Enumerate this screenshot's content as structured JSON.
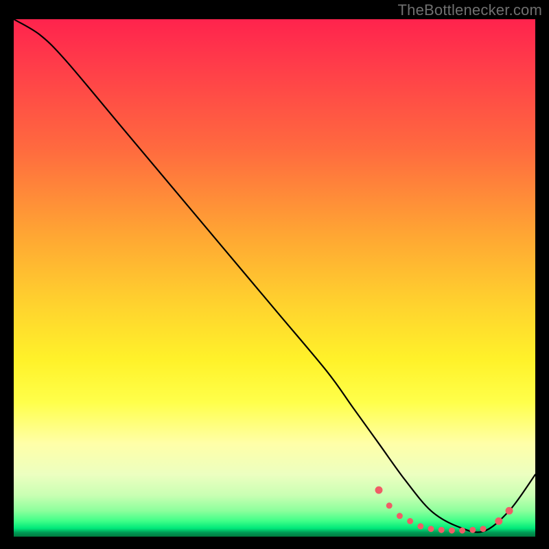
{
  "attribution": "TheBottlenecker.com",
  "chart_data": {
    "type": "line",
    "title": "",
    "xlabel": "",
    "ylabel": "",
    "xlim": [
      0,
      100
    ],
    "ylim": [
      0,
      100
    ],
    "series": [
      {
        "name": "bottleneck-curve",
        "x": [
          0,
          5,
          10,
          20,
          30,
          40,
          50,
          60,
          65,
          70,
          75,
          80,
          85,
          90,
          95,
          100
        ],
        "values": [
          100,
          97,
          92,
          80,
          68,
          56,
          44,
          32,
          25,
          18,
          11,
          5,
          2,
          1,
          5,
          12
        ]
      }
    ],
    "markers": {
      "name": "sweet-spot-dots",
      "x": [
        70,
        72,
        74,
        76,
        78,
        80,
        82,
        84,
        86,
        88,
        90,
        93,
        95
      ],
      "values": [
        9,
        6,
        4,
        3,
        2,
        1.5,
        1.3,
        1.2,
        1.2,
        1.3,
        1.5,
        3,
        5
      ]
    }
  }
}
